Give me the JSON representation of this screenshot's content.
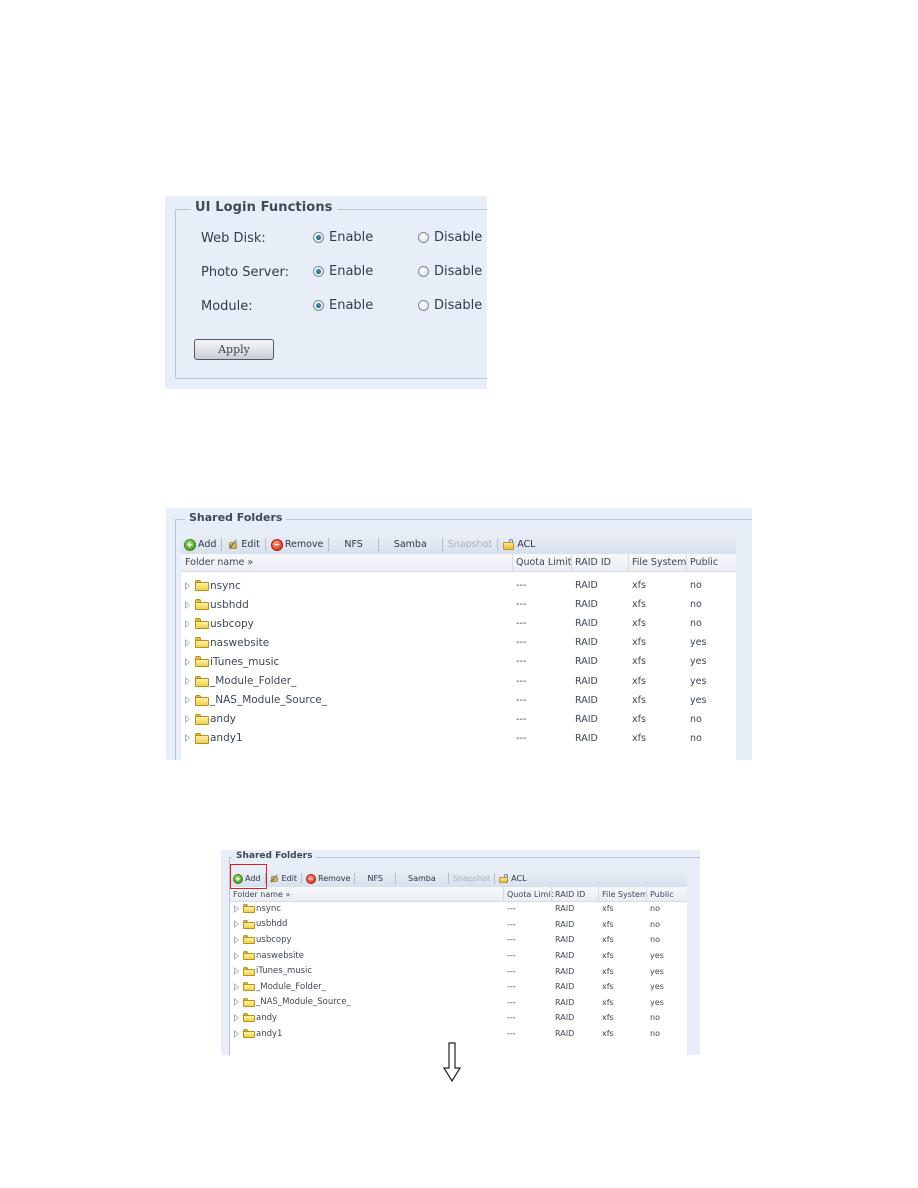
{
  "login_functions": {
    "legend": "UI Login Functions",
    "rows": [
      {
        "label": "Web Disk:",
        "enable": "Enable",
        "disable": "Disable",
        "selected": "enable"
      },
      {
        "label": "Photo Server:",
        "enable": "Enable",
        "disable": "Disable",
        "selected": "enable"
      },
      {
        "label": "Module:",
        "enable": "Enable",
        "disable": "Disable",
        "selected": "enable"
      }
    ],
    "apply_label": "Apply"
  },
  "shared_folders": {
    "legend": "Shared Folders",
    "toolbar": {
      "add": "Add",
      "edit": "Edit",
      "remove": "Remove",
      "nfs": "NFS",
      "samba": "Samba",
      "snapshot": "Snapshot",
      "acl": "ACL"
    },
    "toolbar_icons": {
      "add": "add-circle-icon",
      "edit": "edit-pencil-icon",
      "remove": "remove-circle-icon",
      "acl": "folder-lock-icon"
    },
    "columns": {
      "folder_name": "Folder name »",
      "quota_limit": "Quota Limit",
      "raid_id": "RAID ID",
      "file_system": "File System",
      "public": "Public"
    },
    "rows": [
      {
        "name": "nsync",
        "quota": "---",
        "raid": "RAID",
        "fs": "xfs",
        "public": "no"
      },
      {
        "name": "usbhdd",
        "quota": "---",
        "raid": "RAID",
        "fs": "xfs",
        "public": "no"
      },
      {
        "name": "usbcopy",
        "quota": "---",
        "raid": "RAID",
        "fs": "xfs",
        "public": "no"
      },
      {
        "name": "naswebsite",
        "quota": "---",
        "raid": "RAID",
        "fs": "xfs",
        "public": "yes"
      },
      {
        "name": "iTunes_music",
        "quota": "---",
        "raid": "RAID",
        "fs": "xfs",
        "public": "yes"
      },
      {
        "name": "_Module_Folder_",
        "quota": "---",
        "raid": "RAID",
        "fs": "xfs",
        "public": "yes"
      },
      {
        "name": "_NAS_Module_Source_",
        "quota": "---",
        "raid": "RAID",
        "fs": "xfs",
        "public": "yes"
      },
      {
        "name": "andy",
        "quota": "---",
        "raid": "RAID",
        "fs": "xfs",
        "public": "no"
      },
      {
        "name": "andy1",
        "quota": "---",
        "raid": "RAID",
        "fs": "xfs",
        "public": "no"
      }
    ]
  },
  "annotation": {
    "highlighted_button": "Add",
    "highlight_color": "#e02020",
    "next_step_arrow": "down-arrow-icon"
  }
}
